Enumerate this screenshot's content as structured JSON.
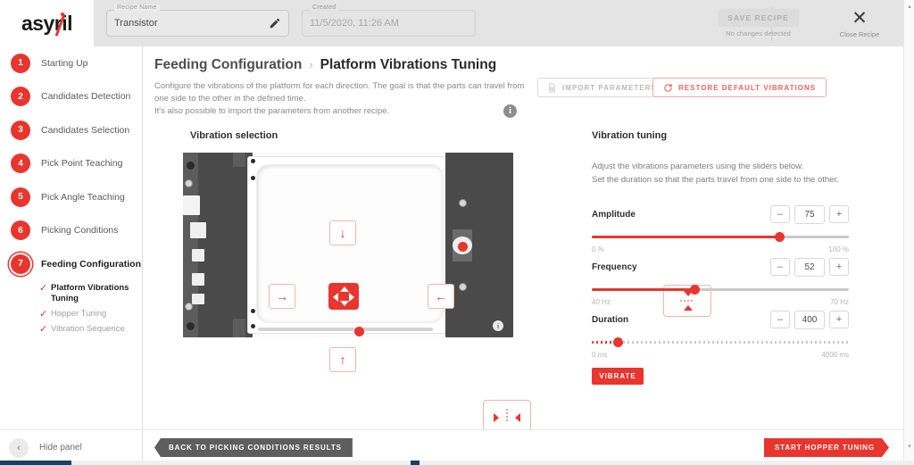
{
  "topbar": {
    "logo": "asyril",
    "recipe_field": {
      "label": "Recipe Name",
      "value": "Transistor",
      "edit_icon": "pencil-icon"
    },
    "created_field": {
      "label": "Created",
      "value": "11/5/2020, 11:26 AM"
    },
    "save_label": "SAVE RECIPE",
    "save_hint": "No changes detected",
    "close_label": "Close Recipe",
    "close_icon": "close-icon"
  },
  "sidebar": {
    "steps": [
      {
        "num": "1",
        "label": "Starting Up"
      },
      {
        "num": "2",
        "label": "Candidates Detection"
      },
      {
        "num": "3",
        "label": "Candidates Selection"
      },
      {
        "num": "4",
        "label": "Pick Point Teaching"
      },
      {
        "num": "5",
        "label": "Pick Angle Teaching"
      },
      {
        "num": "6",
        "label": "Picking Conditions"
      },
      {
        "num": "7",
        "label": "Feeding Configuration"
      }
    ],
    "substeps": [
      {
        "label": "Platform Vibrations Tuning",
        "check": "✓"
      },
      {
        "label": "Hopper Tuning",
        "check": "✓"
      },
      {
        "label": "Vibration Sequence",
        "check": "✓"
      }
    ],
    "hide_panel": {
      "label": "Hide panel",
      "icon": "chevron-left-icon",
      "glyph": "‹"
    }
  },
  "main": {
    "breadcrumb_parent": "Feeding Configuration",
    "breadcrumb_sep": "›",
    "breadcrumb_current": "Platform Vibrations Tuning",
    "description": "Configure the vibrations of the platform for each direction. The goal is that the parts can travel from one side to the other in the defined time.\nIt's also possible to import the parameters from another recipe.",
    "info_glyph": "i",
    "import_label": "IMPORT PARAMETERS",
    "import_icon": "import-document-icon",
    "restore_label": "RESTORE DEFAULT VIBRATIONS",
    "restore_icon": "refresh-icon"
  },
  "vibration_selection": {
    "title": "Vibration selection",
    "directions": {
      "up": "↑",
      "down": "↓",
      "left": "←",
      "right": "→"
    },
    "center_selected": true,
    "platform_info_glyph": "i"
  },
  "vibration_tuning": {
    "title": "Vibration tuning",
    "description": "Adjust the vibrations parameters using the sliders below.\nSet the duration so that the parts travel from one side to the other.",
    "minus": "–",
    "plus": "+",
    "params": [
      {
        "name": "Amplitude",
        "value": "75",
        "min_label": "0 %",
        "max_label": "100 %",
        "percent": 73,
        "ticked": false
      },
      {
        "name": "Frequency",
        "value": "52",
        "min_label": "40 Hz",
        "max_label": "70 Hz",
        "percent": 40,
        "ticked": false
      },
      {
        "name": "Duration",
        "value": "400",
        "min_label": "0 ms",
        "max_label": "4000 ms",
        "percent": 10,
        "ticked": true
      }
    ],
    "vibrate_label": "VIBRATE"
  },
  "footer": {
    "back_label": "BACK TO PICKING CONDITIONS RESULTS",
    "next_label": "START HOPPER TUNING"
  },
  "scrollbar": {
    "up_glyph": "▴",
    "down_glyph": "▾"
  },
  "colors": {
    "accent": "#e8352e",
    "dark": "#4a4a4a",
    "muted": "#8a8a8a"
  }
}
